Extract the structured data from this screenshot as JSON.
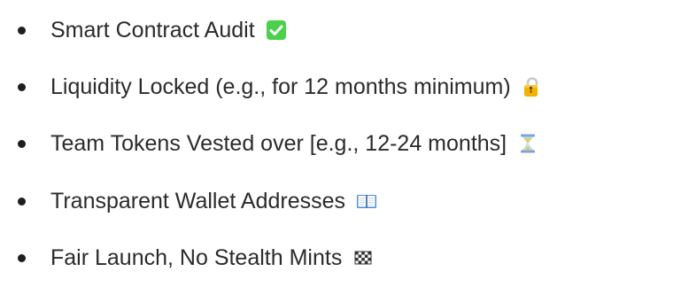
{
  "items": [
    {
      "label": "Smart Contract Audit",
      "icon": "check-mark-button-icon",
      "icon_color": "#4bd14b"
    },
    {
      "label": "Liquidity Locked (e.g., for 12 months minimum)",
      "icon": "lock-icon",
      "icon_color": "#f2b400"
    },
    {
      "label": "Team Tokens Vested over [e.g., 12-24 months]",
      "icon": "hourglass-icon",
      "icon_color": "#69b6e8"
    },
    {
      "label": "Transparent Wallet Addresses",
      "icon": "open-book-icon",
      "icon_color": "#4a90d9"
    },
    {
      "label": "Fair Launch, No Stealth Mints",
      "icon": "checkered-flag-icon",
      "icon_color": "#333333"
    }
  ]
}
